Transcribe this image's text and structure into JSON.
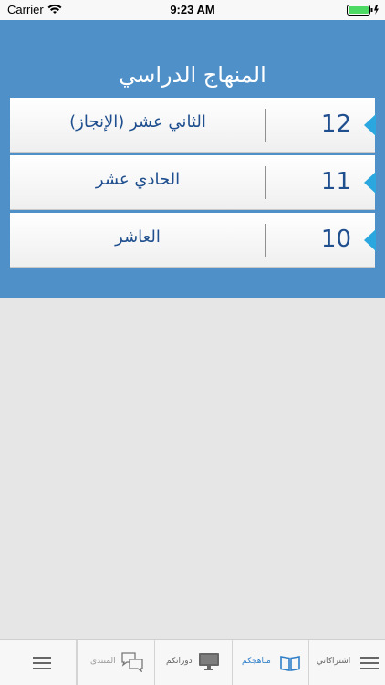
{
  "status_bar": {
    "carrier": "Carrier",
    "time": "9:23 AM"
  },
  "header": {
    "title": "المنهاج الدراسي"
  },
  "grades": [
    {
      "number": "12",
      "name": "الثاني عشر (الإنجاز)"
    },
    {
      "number": "11",
      "name": "الحادي عشر"
    },
    {
      "number": "10",
      "name": "العاشر"
    }
  ],
  "tab_bar": {
    "tabs": [
      {
        "label": "اشتراكاتي",
        "icon": "list-icon"
      },
      {
        "label": "مناهجكم",
        "icon": "book-icon",
        "active": true
      },
      {
        "label": "دوراتكم",
        "icon": "monitor-icon"
      },
      {
        "label": "المنتدى",
        "icon": "chat-icon"
      },
      {
        "label": "",
        "icon": "menu-icon"
      }
    ]
  },
  "colors": {
    "header_background": "#5090c8",
    "accent_arrow": "#2aa7df",
    "text_blue": "#1f4f8f",
    "active_tab": "#2f7fc8",
    "page_background": "#e6e6e6"
  }
}
